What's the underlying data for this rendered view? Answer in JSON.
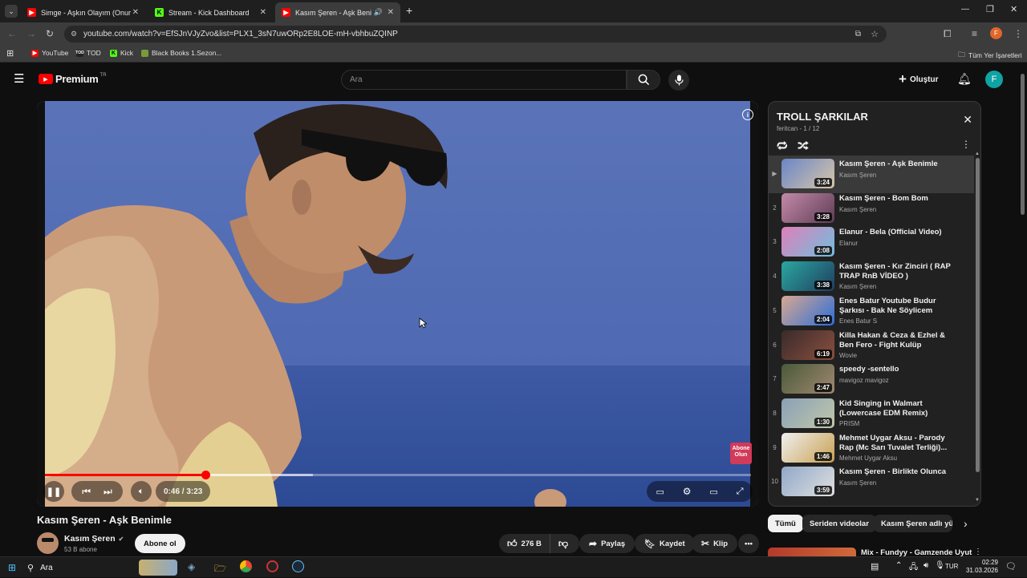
{
  "tabs": [
    {
      "title": "Simge - Aşkın Olayım (Onurr) -",
      "color": "#ff0000"
    },
    {
      "title": "Stream - Kick Dashboard",
      "color": "#53fc18"
    },
    {
      "title": "Kasım Şeren - Aşk Benimle",
      "color": "#ff0000"
    }
  ],
  "address": "youtube.com/watch?v=EfSJnVJyZvo&list=PLX1_3sN7uwORp2E8LOE-mH-vbhbuZQINP",
  "profile_initial": "F",
  "bookmarks": [
    "YouTube",
    "TOD",
    "Kick",
    "Black Books 1.Sezon..."
  ],
  "all_bookmarks": "Tüm Yer İşaretleri",
  "yt": {
    "logo": "Premium",
    "region": "TR",
    "search_placeholder": "Ara",
    "create_label": "Oluştur",
    "avatar": "F"
  },
  "player": {
    "time": "0:46 / 3:23",
    "progress": 0.227,
    "buffered": 0.38,
    "watermark": "Abone Olun"
  },
  "video": {
    "title": "Kasım Şeren - Aşk Benimle",
    "channel": "Kasım Şeren",
    "subs": "53 B abone",
    "subscribe": "Abone ol",
    "likes": "276 B",
    "share": "Paylaş",
    "save": "Kaydet",
    "clip": "Klip"
  },
  "playlist": {
    "title": "TROLL ŞARKILAR",
    "meta": "feritcan - 1 / 12",
    "items": [
      {
        "idx": "▶",
        "title": "Kasım Şeren - Aşk Benimle",
        "channel": "Kasım Şeren",
        "dur": "3:24",
        "c1": "#6a86c8",
        "c2": "#d8c6a8"
      },
      {
        "idx": "2",
        "title": "Kasım Şeren - Bom Bom",
        "channel": "Kasım Şeren",
        "dur": "3:28",
        "c1": "#c48aa8",
        "c2": "#5e3d56"
      },
      {
        "idx": "3",
        "title": "Elanur - Bela (Official Video)",
        "channel": "Elanur",
        "dur": "2:08",
        "c1": "#e07fb8",
        "c2": "#6fbfe0"
      },
      {
        "idx": "4",
        "title": "Kasım Şeren - Kır Zinciri ( RAP TRAP RnB VİDEO )",
        "channel": "Kasım Şeren",
        "dur": "3:38",
        "c1": "#2aa8a0",
        "c2": "#203d60"
      },
      {
        "idx": "5",
        "title": "Enes Batur Youtube Budur Şarkısı - Bak Ne Söylicem",
        "channel": "Enes Batur S",
        "dur": "2:04",
        "c1": "#d8a890",
        "c2": "#2e6ed8"
      },
      {
        "idx": "6",
        "title": "Killa Hakan & Ceza & Ezhel & Ben Fero - Fight Kulüp",
        "channel": "Wovie",
        "dur": "6:19",
        "c1": "#3a2a2a",
        "c2": "#8a5040"
      },
      {
        "idx": "7",
        "title": "speedy -sentello",
        "channel": "mavigoz mavigoz",
        "dur": "2:47",
        "c1": "#4a5a3a",
        "c2": "#a08870"
      },
      {
        "idx": "8",
        "title": "Kid Singing in Walmart (Lowercase EDM Remix)",
        "channel": "PRISM",
        "dur": "1:30",
        "c1": "#8aa0b8",
        "c2": "#c0c8a8"
      },
      {
        "idx": "9",
        "title": "Mehmet Uygar Aksu - Parody Rap (Mc Sarı Tuvalet Terliği)...",
        "channel": "Mehmet Uygar Aksu",
        "dur": "1:46",
        "c1": "#f0f0f0",
        "c2": "#c8a050"
      },
      {
        "idx": "10",
        "title": "Kasım Şeren - Birlikte Olunca",
        "channel": "Kasım Şeren",
        "dur": "3:59",
        "c1": "#90a8c8",
        "c2": "#e0e0e0"
      }
    ]
  },
  "chips": [
    "Tümü",
    "Seriden videolar",
    "Kasım Şeren adlı yük"
  ],
  "next_video": "Mix - Fundyy - Gamzende Uyut",
  "taskbar": {
    "search": "Ara",
    "lang": "TUR",
    "time": "02:29",
    "date": "31.03.2026"
  }
}
